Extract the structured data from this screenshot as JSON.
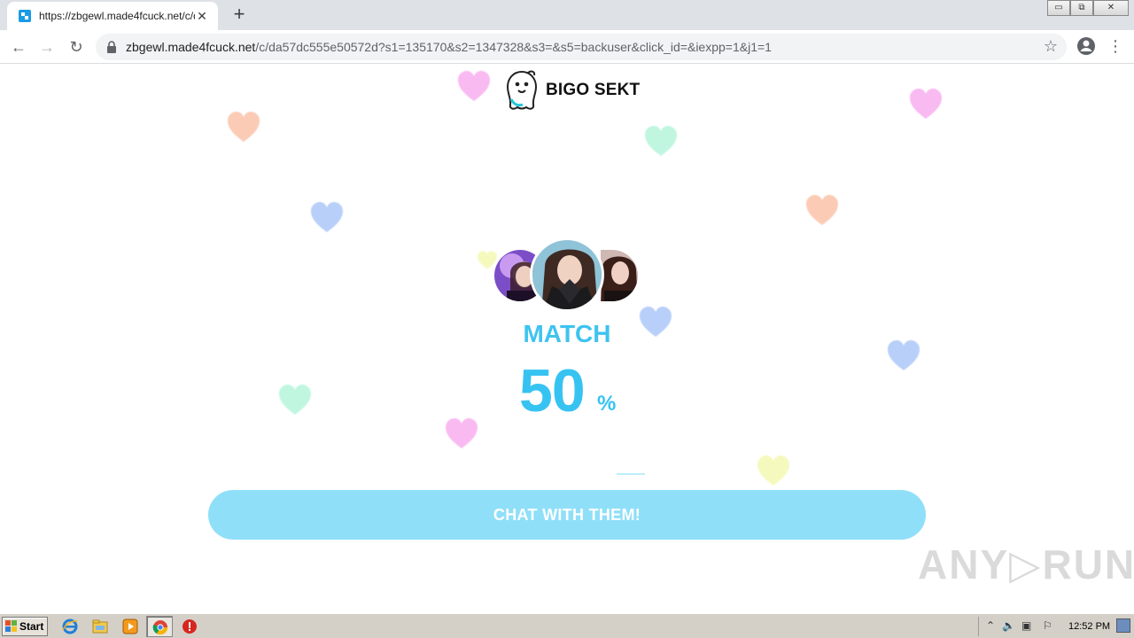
{
  "browser": {
    "tab_title": "https://zbgewl.made4fcuck.net/c/da",
    "tab_close": "✕",
    "new_tab": "+",
    "url_host": "zbgewl.made4fcuck.net",
    "url_path": "/c/da57dc555e50572d?s1=135170&s2=1347328&s3=&s5=backuser&click_id=&iexpp=1&j1=1",
    "back": "←",
    "forward": "→",
    "reload": "↻",
    "star": "☆",
    "menu": "⋮",
    "win_minimize": "▭",
    "win_restore": "⧉",
    "win_close": "✕"
  },
  "page": {
    "brand_name": "BIGO SEKT",
    "match_label": "MATCH",
    "match_percent": "50",
    "percent_sign": "%",
    "match_value": 50,
    "cta_label": "CHAT WITH THEM!",
    "watermark": "ANY▷RUN"
  },
  "colors": {
    "accent": "#36c3f2",
    "cta_bg": "#8fdff9",
    "hearts": [
      "#f8a27c",
      "#f582e6",
      "#7fa9f5",
      "#8ef0c8",
      "#eef58a"
    ]
  },
  "taskbar": {
    "start_label": "Start",
    "clock": "12:52 PM",
    "icons": [
      "ie-icon",
      "explorer-icon",
      "media-player-icon",
      "chrome-icon",
      "stop-icon"
    ]
  }
}
